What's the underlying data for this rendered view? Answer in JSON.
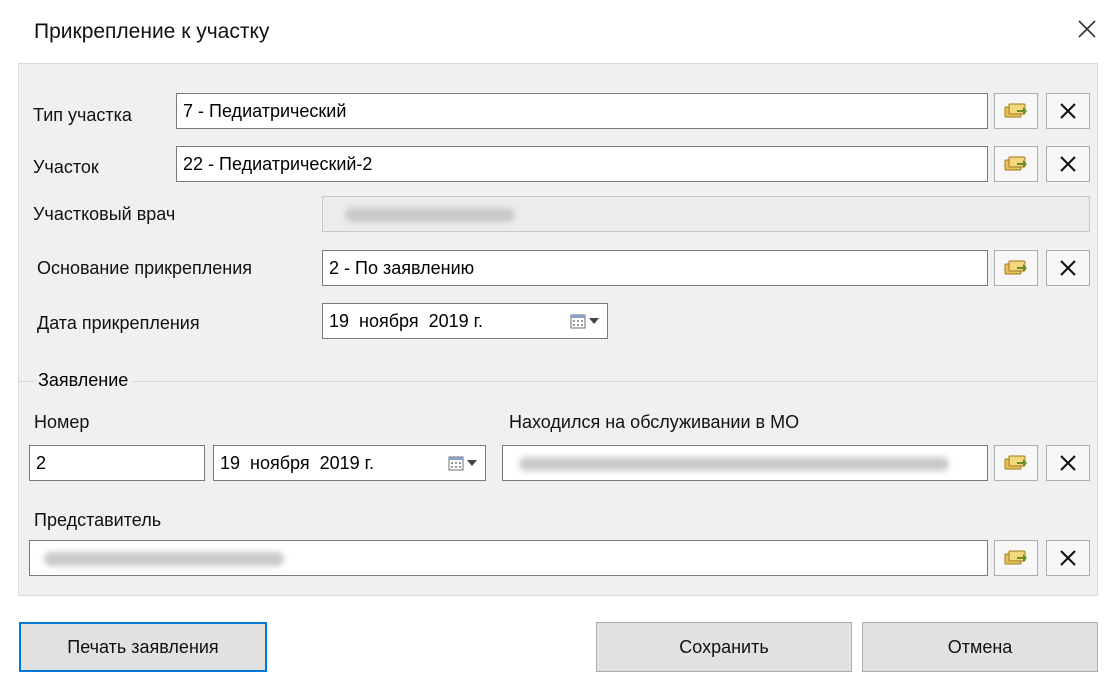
{
  "dialog": {
    "title": "Прикрепление к участку",
    "close_icon": "close-icon"
  },
  "form": {
    "site_type": {
      "label": "Тип участка",
      "value": "7 - Педиатрический"
    },
    "site": {
      "label": "Участок",
      "value": "22 - Педиатрический-2"
    },
    "doctor": {
      "label": "Участковый врач"
    },
    "basis": {
      "label": "Основание прикрепления",
      "value": "2 - По заявлению"
    },
    "attach_date": {
      "label": "Дата прикрепления",
      "day": "19",
      "month": "ноября",
      "year": "2019 г."
    }
  },
  "statement": {
    "group_title": "Заявление",
    "number": {
      "label": "Номер",
      "value": "2"
    },
    "date": {
      "day": "19",
      "month": "ноября",
      "year": "2019 г."
    },
    "mo": {
      "label": "Находился на обслуживании в МО"
    },
    "representative": {
      "label": "Представитель"
    }
  },
  "buttons": {
    "print": "Печать заявления",
    "save": "Сохранить",
    "cancel": "Отмена"
  },
  "colors": {
    "focus": "#0078d7",
    "panel": "#f0f0f0"
  }
}
